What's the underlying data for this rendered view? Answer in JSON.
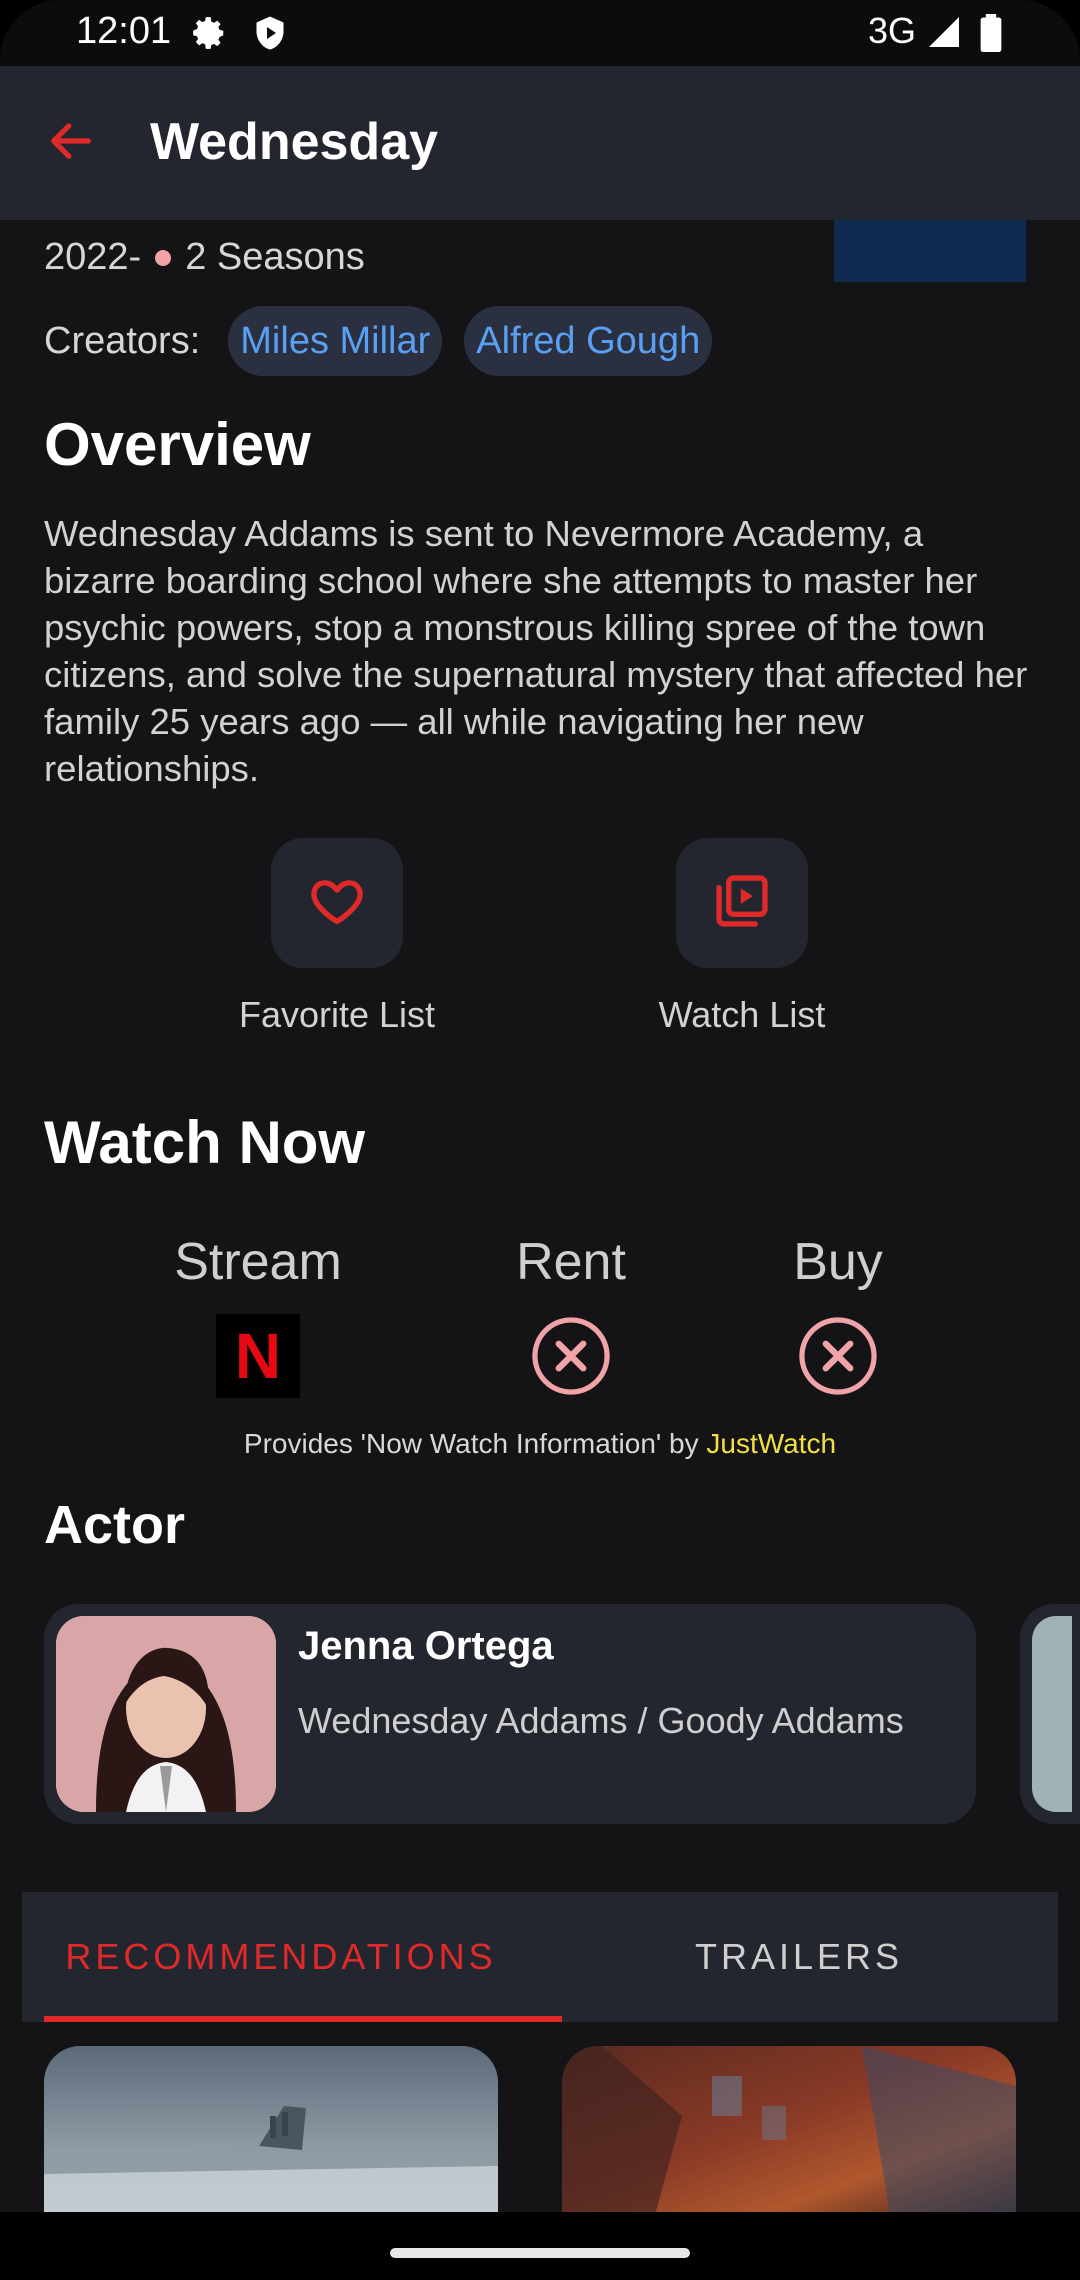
{
  "status_bar": {
    "time": "12:01",
    "network": "3G",
    "icons": [
      "gear-icon",
      "shield-play-icon",
      "signal-icon",
      "battery-icon"
    ]
  },
  "app_bar": {
    "title": "Wednesday",
    "back_icon": "arrow-back-icon"
  },
  "details": {
    "year": "2022-",
    "seasons": "2 Seasons",
    "creators_label": "Creators:",
    "creators": [
      "Miles Millar",
      "Alfred Gough"
    ]
  },
  "overview": {
    "heading": "Overview",
    "text": "Wednesday Addams is sent to Nevermore Academy, a bizarre boarding school where she attempts to master her psychic powers, stop a monstrous killing spree of the town citizens, and solve the supernatural mystery that affected her family 25 years ago — all while navigating her new relationships."
  },
  "actions": {
    "favorite_label": "Favorite List",
    "watch_label": "Watch List"
  },
  "watch_now": {
    "heading": "Watch Now",
    "stream_label": "Stream",
    "rent_label": "Rent",
    "buy_label": "Buy",
    "stream_provider": "N",
    "provides_text": "Provides 'Now Watch Information' by ",
    "provides_brand": "JustWatch"
  },
  "actor": {
    "heading": "Actor",
    "name": "Jenna Ortega",
    "role": "Wednesday Addams / Goody Addams"
  },
  "tabs": {
    "active": "RECOMMENDATIONS",
    "inactive": "TRAILERS"
  },
  "colors": {
    "accent": "#e02a2a",
    "surface": "#23262f",
    "background": "#141416",
    "chip_text": "#5aa0f2",
    "justwatch": "#f0e040"
  }
}
